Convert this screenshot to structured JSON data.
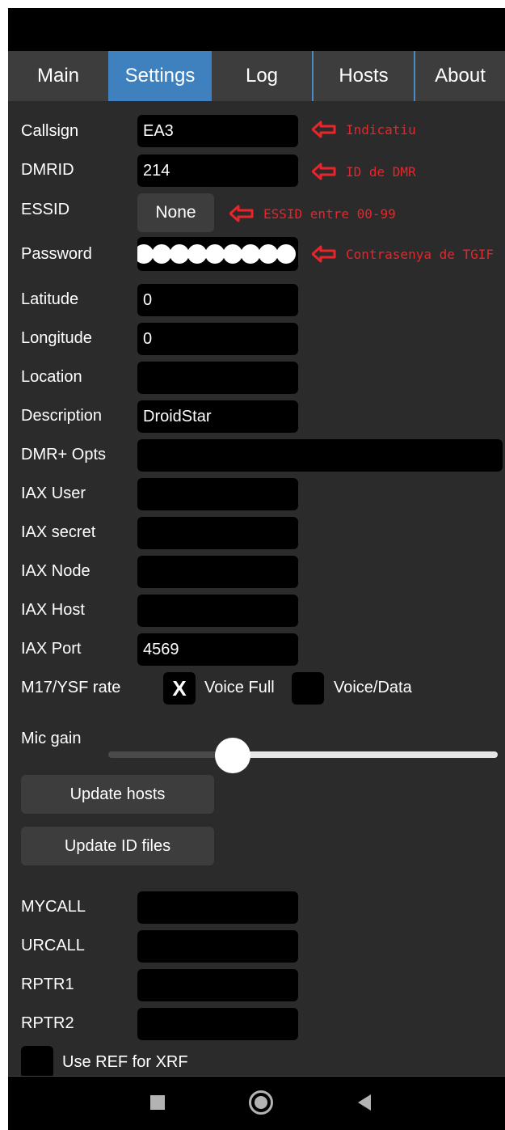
{
  "tabs": [
    "Main",
    "Settings",
    "Log",
    "Hosts",
    "About"
  ],
  "active_tab": "Settings",
  "fields": {
    "callsign": {
      "label": "Callsign",
      "value": "EA3"
    },
    "dmrid": {
      "label": "DMRID",
      "value": "214"
    },
    "essid": {
      "label": "ESSID",
      "value": "None"
    },
    "password": {
      "label": "Password",
      "dots": 9
    },
    "latitude": {
      "label": "Latitude",
      "value": "0"
    },
    "longitude": {
      "label": "Longitude",
      "value": "0"
    },
    "location": {
      "label": "Location",
      "value": ""
    },
    "description": {
      "label": "Description",
      "value": "DroidStar"
    },
    "dmr_opts": {
      "label": "DMR+ Opts",
      "value": ""
    },
    "iax_user": {
      "label": "IAX User",
      "value": ""
    },
    "iax_secret": {
      "label": "IAX secret",
      "value": ""
    },
    "iax_node": {
      "label": "IAX Node",
      "value": ""
    },
    "iax_host": {
      "label": "IAX Host",
      "value": ""
    },
    "iax_port": {
      "label": "IAX Port",
      "value": "4569"
    },
    "mycall": {
      "label": "MYCALL",
      "value": ""
    },
    "urcall": {
      "label": "URCALL",
      "value": ""
    },
    "rptr1": {
      "label": "RPTR1",
      "value": ""
    },
    "rptr2": {
      "label": "RPTR2",
      "value": ""
    }
  },
  "annotations": {
    "callsign": "Indicatiu",
    "dmrid": "ID de DMR",
    "essid": "ESSID entre 00-99",
    "password": "Contrasenya de TGIF",
    "color": "#e8252b"
  },
  "rate": {
    "label": "M17/YSF rate",
    "voice_full": {
      "label": "Voice Full",
      "mark": "X",
      "checked": true
    },
    "voice_data": {
      "label": "Voice/Data",
      "checked": false
    }
  },
  "mic_gain": {
    "label": "Mic gain",
    "value_fraction": 0.32
  },
  "buttons": {
    "update_hosts": "Update hosts",
    "update_id_files": "Update ID files"
  },
  "use_ref": {
    "label": "Use REF for XRF",
    "checked": false
  },
  "colors": {
    "accent": "#3f80bf",
    "background": "#2b2b2b",
    "field": "#000000"
  }
}
